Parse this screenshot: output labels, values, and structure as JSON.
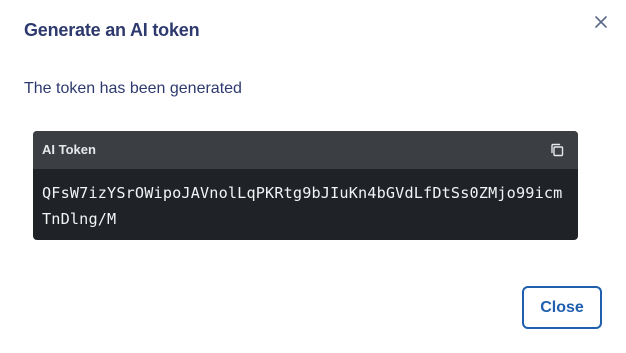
{
  "dialog": {
    "title": "Generate an AI token",
    "close_icon": "close-icon",
    "message": "The token has been generated",
    "token": {
      "label": "AI Token",
      "value": "QFsW7izYSrOWipoJAVnolLqPKRtg9bJIuKn4bGVdLfDtSs0ZMjo99icmTnDlng/M",
      "copy_icon": "copy-icon"
    },
    "close_button_label": "Close"
  },
  "colors": {
    "title": "#2e3a6e",
    "accent": "#1f5fae",
    "token_bg": "#1f2226",
    "token_header_bg": "#3b3e43"
  }
}
